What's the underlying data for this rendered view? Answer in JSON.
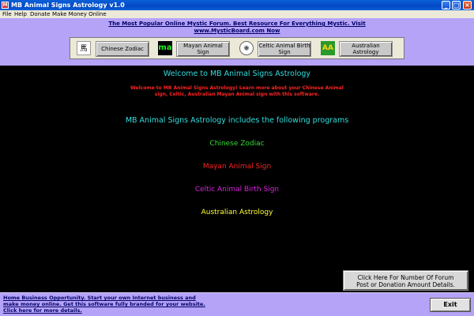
{
  "window": {
    "title": "MB Animal Signs Astrology v1.0",
    "minimize_glyph": "_",
    "maximize_glyph": "□",
    "close_glyph": "×"
  },
  "menu": {
    "items": [
      "File",
      "Help",
      "Donate",
      "Make Money Online"
    ]
  },
  "top_ad": {
    "line1": "The Most Popular Online Mystic Forum. Best Resource For Everything Mystic. Visit",
    "line2": "www.MysticBoard.com Now"
  },
  "programs": [
    {
      "label": "Chinese Zodiac",
      "icon": "chinese-character-icon",
      "icon_glyph": "馬"
    },
    {
      "label": "Mayan Animal Sign",
      "icon": "mayan-ma-icon",
      "icon_glyph": "ma"
    },
    {
      "label": "Celtic Animal Birth Sign",
      "icon": "celtic-knot-icon",
      "icon_glyph": "✺"
    },
    {
      "label": "Australian Astrology",
      "icon": "australian-aa-icon",
      "icon_glyph": "AA"
    }
  ],
  "main": {
    "welcome_title": "Welcome to MB Animal Signs Astrology",
    "welcome_sub_line1": "Welcome to MB Animal Signs Astrology! Learn more about your Chinese Animal",
    "welcome_sub_line2": "sign, Celtic, Australian Mayan Animal sign with this software.",
    "includes_heading": "MB Animal Signs Astrology includes the following programs",
    "program_links": [
      {
        "label": "Chinese Zodiac",
        "color": "#33dd33"
      },
      {
        "label": "Mayan Animal Sign",
        "color": "#ff2222"
      },
      {
        "label": "Celtic Animal Birth Sign",
        "color": "#dd22dd"
      },
      {
        "label": "Australian Astrology",
        "color": "#ffff33"
      }
    ]
  },
  "forum_button": {
    "line1": "Click Here For Number Of Forum",
    "line2": "Post or Donation Amount Details."
  },
  "bottom_ad": {
    "line1": "Home Business Opportunity. Start your own Internet business and",
    "line2": "make money online. Get this software fully branded for your website.",
    "line3": "Click here for more details."
  },
  "exit_label": "Exit",
  "colors": {
    "panel_purple": "#b5a3f8",
    "title_cyan": "#33dddd",
    "welcome_red": "#ff2222"
  }
}
